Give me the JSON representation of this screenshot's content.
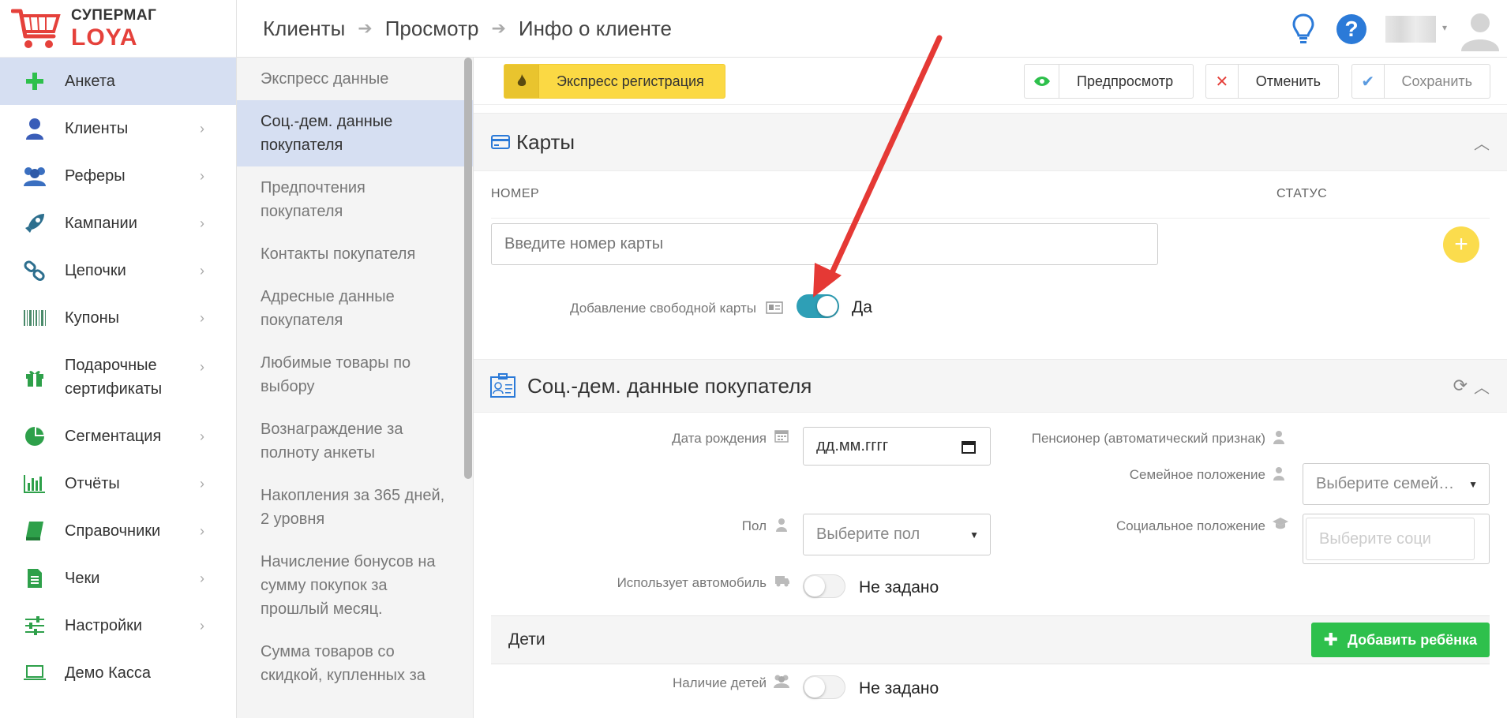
{
  "logo": {
    "line1": "СУПЕРМАГ",
    "line2": "LOYA"
  },
  "sidebar": {
    "items": [
      {
        "label": "Анкета",
        "icon": "plus-icon"
      },
      {
        "label": "Клиенты",
        "icon": "user-icon"
      },
      {
        "label": "Реферы",
        "icon": "users-icon"
      },
      {
        "label": "Кампании",
        "icon": "rocket-icon"
      },
      {
        "label": "Цепочки",
        "icon": "chain-icon"
      },
      {
        "label": "Купоны",
        "icon": "barcode-icon"
      },
      {
        "label": "Подарочные сертификаты",
        "icon": "gift-icon"
      },
      {
        "label": "Сегментация",
        "icon": "pie-chart-icon"
      },
      {
        "label": "Отчёты",
        "icon": "bar-chart-icon"
      },
      {
        "label": "Справочники",
        "icon": "book-icon"
      },
      {
        "label": "Чеки",
        "icon": "receipt-icon"
      },
      {
        "label": "Настройки",
        "icon": "sliders-icon"
      },
      {
        "label": "Демо Касса",
        "icon": "laptop-icon"
      }
    ]
  },
  "breadcrumb": {
    "a": "Клиенты",
    "b": "Просмотр",
    "c": "Инфо о клиенте"
  },
  "subnav": {
    "items": [
      "Экспресс данные",
      "Соц.-дем. данные покупателя",
      "Предпочтения покупателя",
      "Контакты покупателя",
      "Адресные данные покупателя",
      "Любимые товары по выбору",
      "Вознаграждение за полноту анкеты",
      "Накопления за 365 дней, 2 уровня",
      "Начисление бонусов на сумму покупок за прошлый месяц.",
      "Сумма товаров со скидкой, купленных за"
    ]
  },
  "toolbar": {
    "express": "Экспресс регистрация",
    "preview": "Предпросмотр",
    "cancel": "Отменить",
    "save": "Сохранить"
  },
  "cards": {
    "title": "Карты",
    "col_number": "НОМЕР",
    "col_status": "СТАТУС",
    "input_placeholder": "Введите номер карты",
    "free_card_label": "Добавление свободной карты",
    "free_card_value": "Да"
  },
  "socdem": {
    "title": "Соц.-дем. данные покупателя",
    "birth_label": "Дата рождения",
    "birth_value": "дд.мм.гггг",
    "pensioner_label": "Пенсионер (автоматический признак)",
    "family_label": "Семейное положение",
    "family_placeholder": "Выберите семей…",
    "gender_label": "Пол",
    "gender_placeholder": "Выберите пол",
    "social_label": "Социальное положение",
    "social_placeholder": "Выберите соци",
    "car_label": "Использует автомобиль",
    "car_value": "Не задано",
    "kids_title": "Дети",
    "add_child": "Добавить ребёнка",
    "has_kids_label": "Наличие детей",
    "has_kids_value": "Не задано"
  },
  "colors": {
    "accent_blue": "#2b7ad8",
    "toggle_on": "#2e9fb6",
    "express_yellow": "#fbd944",
    "add_green": "#2ec04c",
    "annotation_arrow": "#e53935"
  }
}
